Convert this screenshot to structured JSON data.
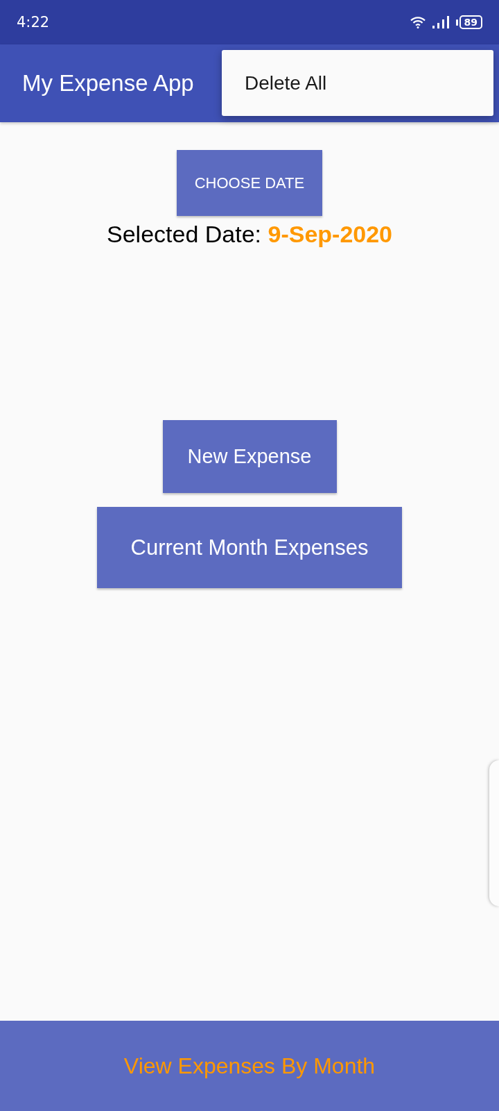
{
  "status_bar": {
    "time": "4:22",
    "battery": "89"
  },
  "app_bar": {
    "title": "My Expense App"
  },
  "overflow_menu": {
    "items": [
      {
        "label": "Delete All"
      }
    ]
  },
  "choose_date_button": {
    "label": "CHOOSE DATE"
  },
  "selected_date": {
    "label": "Selected Date:",
    "value": "9-Sep-2020"
  },
  "actions": [
    {
      "label": "New Expense"
    },
    {
      "label": "Current Month Expenses"
    }
  ],
  "bottom_button": {
    "label": "View Expenses By Month"
  }
}
